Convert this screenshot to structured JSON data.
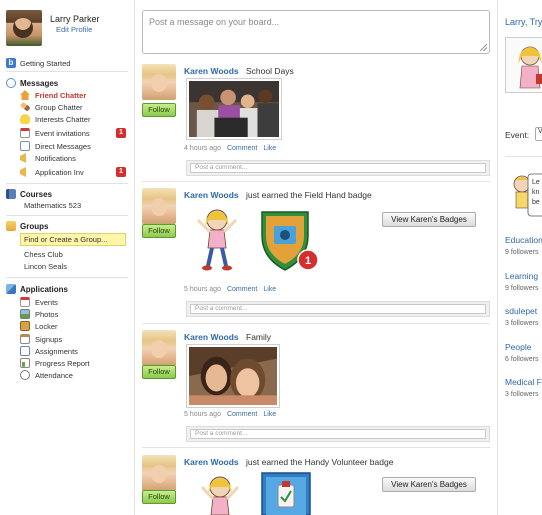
{
  "profile": {
    "name": "Larry Parker",
    "edit_link": "Edit Profile"
  },
  "sidebar": {
    "getting_started": "Getting Started",
    "messages": {
      "title": "Messages",
      "items": [
        {
          "label": "Friend Chatter",
          "active": true
        },
        {
          "label": "Group Chatter"
        },
        {
          "label": "Interests Chatter"
        },
        {
          "label": "Event invitations",
          "badge": "1"
        },
        {
          "label": "Direct Messages"
        },
        {
          "label": "Notifications"
        },
        {
          "label": "Application Inv",
          "badge": "1"
        }
      ]
    },
    "courses": {
      "title": "Courses",
      "items": [
        "Mathematics 523"
      ]
    },
    "groups": {
      "title": "Groups",
      "find": "Find or Create a Group...",
      "items": [
        "Chess Club",
        "Lincon Seals"
      ]
    },
    "applications": {
      "title": "Applications",
      "items": [
        "Events",
        "Photos",
        "Locker",
        "Signups",
        "Assignments",
        "Progress Report",
        "Attendance"
      ]
    }
  },
  "composer": {
    "placeholder": "Post a message on your board..."
  },
  "feed": [
    {
      "author": "Karen Woods",
      "text": "School Days",
      "time": "4 hours ago",
      "comment_link": "Comment",
      "like_link": "Like",
      "follow": "Follow",
      "comment_placeholder": "Post a comment..."
    },
    {
      "author": "Karen Woods",
      "text": "just earned the Field Hand badge",
      "time": "5 hours ago",
      "comment_link": "Comment",
      "like_link": "Like",
      "follow": "Follow",
      "badge_button": "View Karen's Badges",
      "badge_count": "1",
      "comment_placeholder": "Post a comment..."
    },
    {
      "author": "Karen Woods",
      "text": "Family",
      "time": "5 hours ago",
      "comment_link": "Comment",
      "like_link": "Like",
      "follow": "Follow",
      "comment_placeholder": "Post a comment..."
    },
    {
      "author": "Karen Woods",
      "text": "just earned the Handy Volunteer badge",
      "follow": "Follow",
      "badge_button": "View Karen's Badges"
    }
  ],
  "right": {
    "name_link": "Larry, Try",
    "event_label": "Event:",
    "event_select": "V",
    "bubble_text": "Le\nkn\nbe",
    "groups": [
      {
        "name": "Education",
        "followers": "9 followers"
      },
      {
        "name": "Learning",
        "followers": "9 followers"
      },
      {
        "name": "sdulepet",
        "followers": "3 followers"
      },
      {
        "name": "People",
        "followers": "6 followers"
      },
      {
        "name": "Medical F",
        "followers": "3 followers"
      }
    ]
  },
  "colors": {
    "link": "#2f68a6",
    "badge_red": "#d32f2f",
    "follow_green": "#8ec84e",
    "active_nav": "#c0392b",
    "find_group_bg": "#fff6a8"
  }
}
